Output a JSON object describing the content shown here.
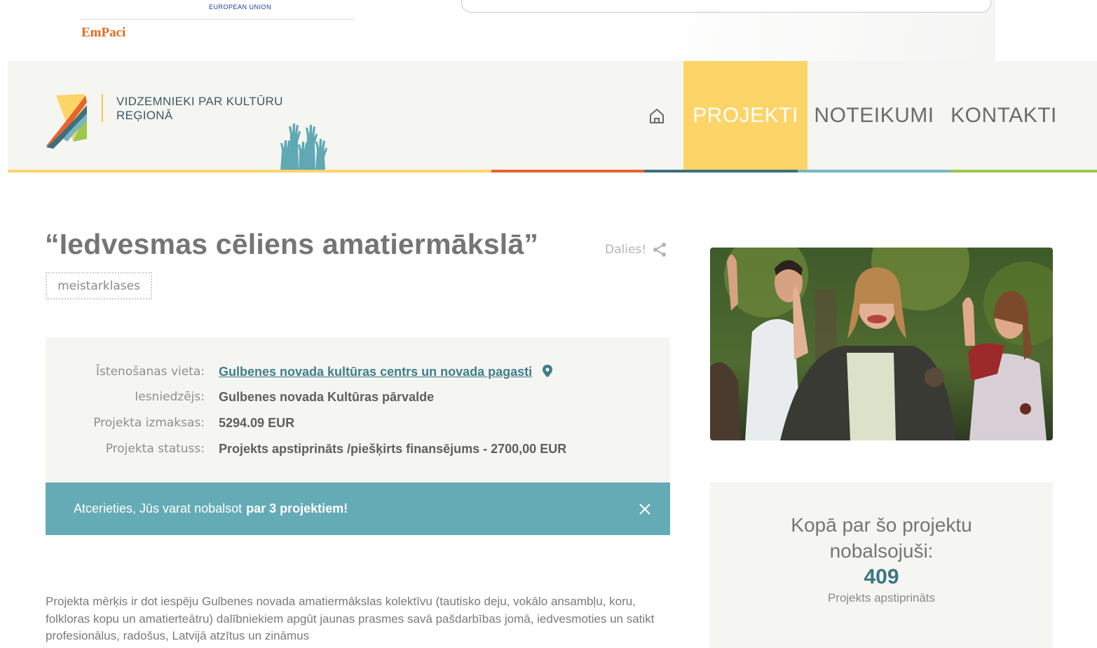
{
  "top": {
    "eu_text": "EUROPEAN UNION",
    "partner_logo": "EmPaci"
  },
  "header": {
    "site_title_line1": "VIDZEMNIEKI PAR KULTŪRU",
    "site_title_line2": "REĢIONĀ",
    "nav": [
      {
        "label": "PROJEKTI",
        "active": true
      },
      {
        "label": "NOTEIKUMI",
        "active": false
      },
      {
        "label": "KONTAKTI",
        "active": false
      }
    ],
    "home_icon": "home-icon",
    "accent_colors": [
      "#fdd468",
      "#e8632f",
      "#3d6f7c",
      "#7ab6c2",
      "#9cc74a"
    ]
  },
  "project": {
    "title": "“Iedvesmas cēliens amatiermākslā”",
    "share_label": "Dalies!",
    "tag": "meistarklases",
    "info": [
      {
        "label": "Īstenošanas vieta:",
        "value": "Gulbenes novada kultūras centrs un novada pagasti",
        "link": true
      },
      {
        "label": "Iesniedzējs:",
        "value": "Gulbenes novada Kultūras pārvalde",
        "link": false
      },
      {
        "label": "Projekta izmaksas:",
        "value": "5294.09 EUR",
        "link": false
      },
      {
        "label": "Projekta statuss:",
        "value": "Projekts apstiprināts /piešķirts finansējums - 2700,00 EUR",
        "link": false
      }
    ],
    "notice_text": "Atcerieties, Jūs varat nobalsot",
    "notice_bold": "par 3 projektiem!",
    "description": "Projekta mērķis ir dot iespēju Gulbenes novada amatiermākslas kolektīvu (tautisko deju, vokālo ansambļu, koru, folkloras kopu un amatierteātru) dalībniekiem apgūt jaunas prasmes savā pašdarbības jomā, iedvesmoties un satikt profesionālus, radošus, Latvijā atzītus un zināmus"
  },
  "votes": {
    "heading_line1": "Kopā par šo projektu",
    "heading_line2": "nobalsojuši:",
    "count": "409",
    "status": "Projekts apstiprināts"
  }
}
